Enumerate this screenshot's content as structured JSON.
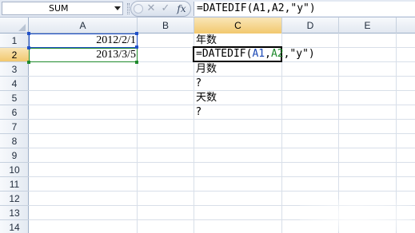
{
  "formula_bar": {
    "name_box": "SUM",
    "cancel_icon": "✕",
    "enter_icon": "✓",
    "fx_label": "fx",
    "formula_text": "=DATEDIF(A1,A2,\"y\")"
  },
  "columns": [
    "A",
    "B",
    "C",
    "D",
    "E"
  ],
  "rows": [
    "1",
    "2",
    "3",
    "4",
    "5",
    "6",
    "7",
    "8",
    "9",
    "10",
    "11",
    "12",
    "13",
    "14"
  ],
  "cells": {
    "A1": "2012/2/1",
    "A2": "2013/3/5",
    "C1": "年数",
    "C2_prefix": "=DATEDIF(",
    "C2_ref1": "A1",
    "C2_sep": ",",
    "C2_ref2": "A2",
    "C2_suffix": ",\"y\")",
    "C3": "月数",
    "C4": "?",
    "C5": "天数",
    "C6": "?"
  },
  "colors": {
    "ref_a1": "#1c49b5",
    "ref_a2": "#1f8a2c",
    "header_selected": "#f2c86e"
  }
}
